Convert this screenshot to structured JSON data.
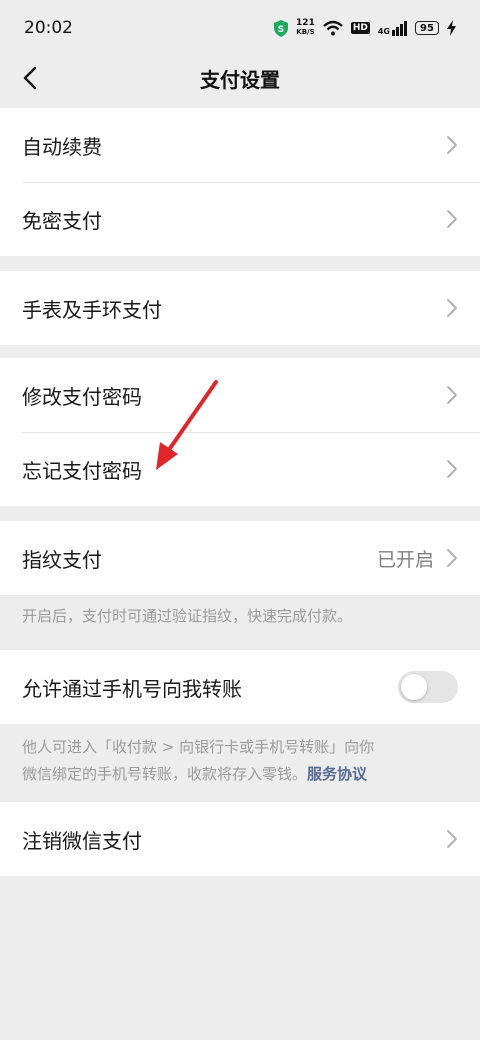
{
  "status_bar": {
    "time": "20:02",
    "net_speed_value": "121",
    "net_speed_unit": "KB/S",
    "hd": "HD",
    "signal": "4G",
    "battery": "95"
  },
  "nav": {
    "title": "支付设置"
  },
  "groups": {
    "g1": [
      {
        "label": "自动续费"
      },
      {
        "label": "免密支付"
      }
    ],
    "g2": [
      {
        "label": "手表及手环支付"
      }
    ],
    "g3": [
      {
        "label": "修改支付密码"
      },
      {
        "label": "忘记支付密码"
      }
    ],
    "g4": {
      "label": "指纹支付",
      "value": "已开启",
      "note": "开启后，支付时可通过验证指纹，快速完成付款。"
    },
    "g5": {
      "label": "允许通过手机号向我转账",
      "toggle_on": false,
      "note_line1": "他人可进入「收付款 > 向银行卡或手机号转账」向你",
      "note_line2": "微信绑定的手机号转账，收款将存入零钱。",
      "note_link": "服务协议"
    },
    "g6": [
      {
        "label": "注销微信支付"
      }
    ]
  },
  "colors": {
    "background": "#ededed",
    "link": "#576b95",
    "annotation_arrow": "#e0262b"
  }
}
